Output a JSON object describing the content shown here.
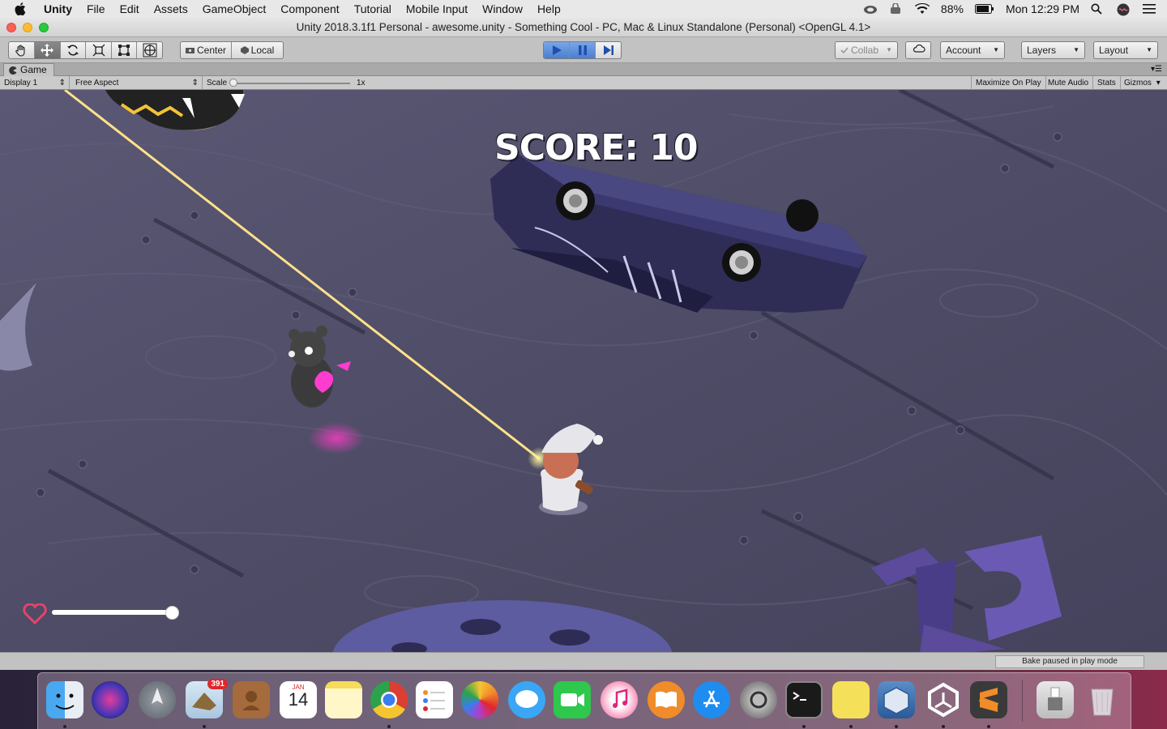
{
  "menubar": {
    "app_name": "Unity",
    "items": [
      "File",
      "Edit",
      "Assets",
      "GameObject",
      "Component",
      "Tutorial",
      "Mobile Input",
      "Window",
      "Help"
    ],
    "battery": "88%",
    "clock": "Mon 12:29 PM"
  },
  "window": {
    "title": "Unity 2018.3.1f1 Personal - awesome.unity - Something Cool - PC, Mac & Linux Standalone (Personal) <OpenGL 4.1>"
  },
  "toolbar": {
    "tools": [
      "hand-tool-icon",
      "move-tool-icon",
      "rotate-tool-icon",
      "scale-tool-icon",
      "rect-tool-icon",
      "transform-tool-icon"
    ],
    "center_label": "Center",
    "local_label": "Local",
    "collab_label": "Collab",
    "account_label": "Account",
    "layers_label": "Layers",
    "layout_label": "Layout"
  },
  "game_view": {
    "tab_label": "Game",
    "display_label": "Display 1",
    "aspect_label": "Free Aspect",
    "scale_label": "Scale",
    "scale_value": "1x",
    "maximize_label": "Maximize On Play",
    "mute_label": "Mute Audio",
    "stats_label": "Stats",
    "gizmos_label": "Gizmos"
  },
  "game": {
    "score_text": "SCORE: 10",
    "health_value": 1.0
  },
  "status": {
    "bake_text": "Bake paused in play mode"
  },
  "dock": {
    "mail_badge": "391",
    "calendar_month": "JAN",
    "calendar_day": "14",
    "apps": [
      "Finder",
      "Siri",
      "Launchpad",
      "Mail",
      "Contacts",
      "Calendar",
      "Notes",
      "Chrome",
      "Reminders",
      "Photos",
      "Messages",
      "FaceTime",
      "iTunes",
      "iBooks",
      "App Store",
      "System Preferences",
      "Terminal",
      "Stickies",
      "VirtualBox",
      "Unity",
      "Sublime Text",
      "Downloads",
      "Trash"
    ]
  },
  "colors": {
    "play_accent": "#4a7fd0",
    "floor": "#4e4c64",
    "laser": "#ffe08a",
    "heart": "#e8426b"
  }
}
